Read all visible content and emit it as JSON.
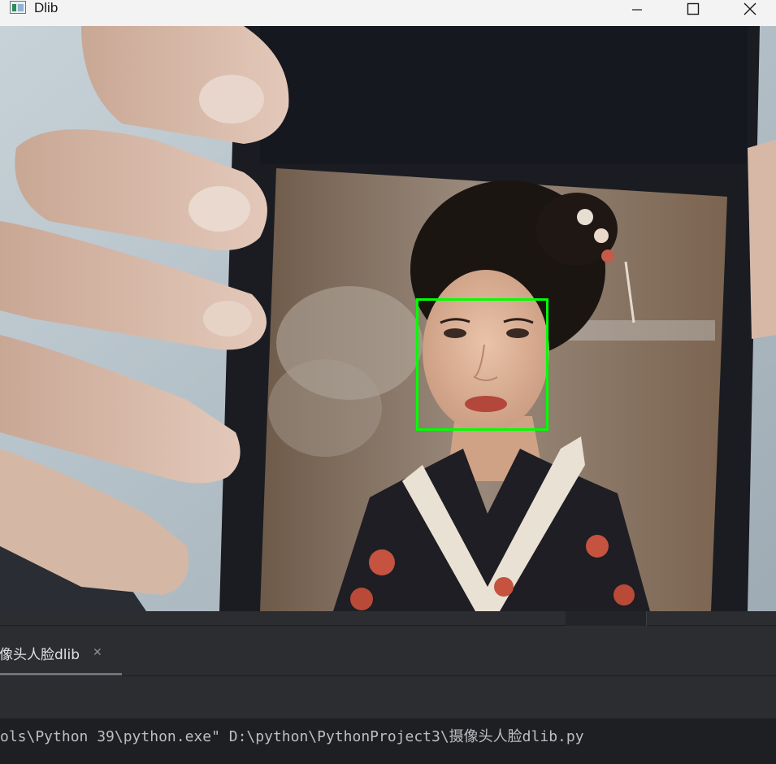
{
  "window": {
    "title": "Dlib",
    "controls": [
      "minimize",
      "maximize",
      "close"
    ]
  },
  "detection": {
    "face_count": 1,
    "box_color": "#00ff00"
  },
  "ide": {
    "run_tab_label": "像头人脸dlib",
    "console_command": "ols\\Python 39\\python.exe\" D:\\python\\PythonProject3\\摄像头人脸dlib.py"
  },
  "colors": {
    "titlebar": "#f3f3f3",
    "ide_panel": "#2b2d30",
    "console_bg": "#1e1f22",
    "console_text": "#bcbec4"
  }
}
